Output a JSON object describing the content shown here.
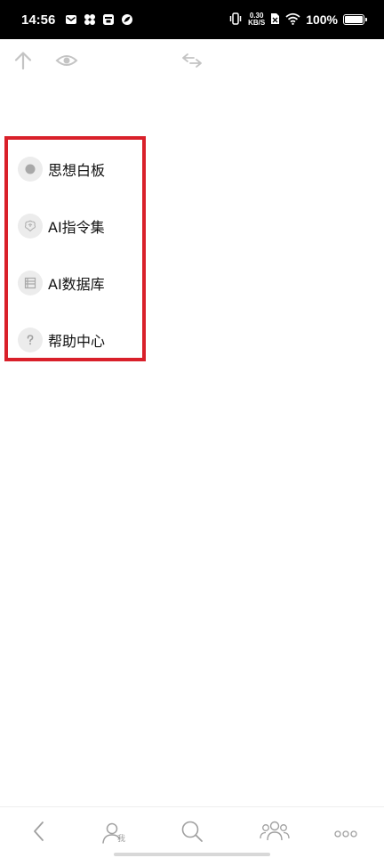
{
  "status_bar": {
    "time": "14:56",
    "notifications": [
      "mail-icon",
      "pinwheel-icon",
      "store-icon",
      "leaf-app-icon"
    ],
    "net_speed_value": "0.30",
    "net_speed_unit": "KB/S",
    "battery_percent": "100%",
    "battery_level": 1.0
  },
  "toolbar": {
    "icons": [
      "arrow-up-icon",
      "eye-icon",
      "swap-arrows-icon"
    ]
  },
  "menu": {
    "items": [
      {
        "label": "思想白板",
        "icon": "dot-icon"
      },
      {
        "label": "AI指令集",
        "icon": "brain-icon"
      },
      {
        "label": "AI数据库",
        "icon": "database-icon"
      },
      {
        "label": "帮助中心",
        "icon": "question-icon"
      }
    ]
  },
  "bottom_nav": {
    "me_label": "我",
    "icons": [
      "back-icon",
      "profile-icon",
      "search-icon",
      "group-icon",
      "more-icon"
    ]
  },
  "colors": {
    "highlight": "#d9202a",
    "icon_gray": "#b5b5b5",
    "icon_bg": "#ececec"
  }
}
